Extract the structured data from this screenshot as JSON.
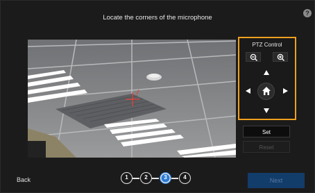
{
  "header": {
    "title": "Locate the corners of the microphone",
    "help_icon": "?"
  },
  "ptz": {
    "title": "PTZ Control",
    "zoom_out_icon": "zoom-out-icon",
    "zoom_in_icon": "zoom-in-icon",
    "home_icon": "home-icon"
  },
  "actions": {
    "set_label": "Set",
    "reset_label": "Reset"
  },
  "footer": {
    "back_label": "Back",
    "steps": [
      "1",
      "2",
      "3",
      "4"
    ],
    "current_step": "3",
    "next_label": "Next"
  },
  "colors": {
    "highlight": "#f0a020",
    "accent": "#2a7bd4",
    "marker": "#e8403a"
  }
}
